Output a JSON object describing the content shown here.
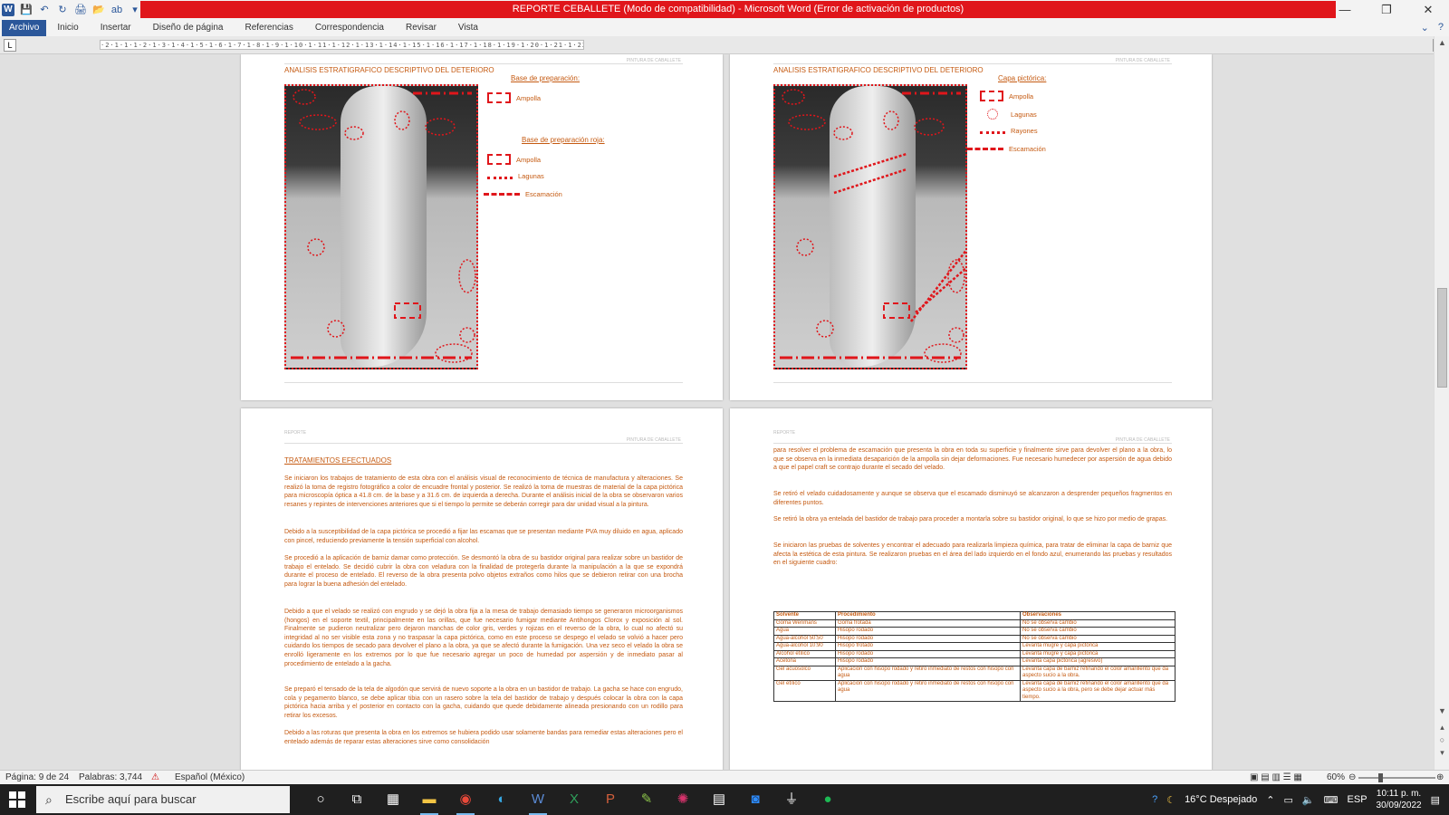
{
  "window": {
    "title": "REPORTE CEBALLETE (Modo de compatibilidad) - Microsoft Word (Error de activación de productos)",
    "min": "—",
    "max": "❐",
    "close": "✕"
  },
  "ribbon": {
    "tabs": [
      "Archivo",
      "Inicio",
      "Insertar",
      "Diseño de página",
      "Referencias",
      "Correspondencia",
      "Revisar",
      "Vista"
    ]
  },
  "ruler": {
    "text": "·2·1·1·1·2·1·3·1·4·1·5·1·6·1·7·1·8·1·9·1·10·1·11·1·12·1·13·1·14·1·15·1·16·1·17·1·18·1·19·1·20·1·21·1·22·1·23·1·24·1"
  },
  "page1": {
    "title": "ANALISIS ESTRATIGRAFICO DESCRIPTIVO DEL DETERIORO",
    "header": "PINTURA DE CABALLETE",
    "legend_title1": "Base de preparación:",
    "legend_title2": "Base de preparación roja:",
    "items": [
      "Ampolla",
      "Ampolla",
      "Lagunas",
      "Escamación"
    ]
  },
  "page2": {
    "title": "ANALISIS ESTRATIGRAFICO DESCRIPTIVO DEL DETERIORO",
    "header": "PINTURA DE CABALLETE",
    "legend_title": "Capa pictórica:",
    "items": [
      "Ampolla",
      "Lagunas",
      "Rayones",
      "Escamación"
    ]
  },
  "page3": {
    "header_left": "REPORTE",
    "header_right": "PINTURA DE CABALLETE",
    "title": "TRATAMIENTOS EFECTUADOS",
    "paragraphs": [
      "Se iniciaron los trabajos de tratamiento de esta obra con el análisis visual de reconocimiento de técnica de manufactura y alteraciones. Se realizó la toma de registro fotográfico a color de encuadre frontal y posterior. Se realizó la toma de muestras de material de la capa pictórica para microscopía óptica a 41.8 cm. de la base y a 31.6 cm. de izquierda a derecha. Durante el análisis inicial de la obra se observaron varios resanes y repintes de intervenciones anteriores que si el tiempo lo permite se deberán corregir para dar unidad visual a la pintura.",
      "Debido a la susceptibilidad de la capa pictórica se procedió a fijar las escamas que se presentan mediante PVA muy diluido en agua, aplicado con pincel, reduciendo previamente la tensión superficial con alcohol.",
      "Se procedió a la aplicación de barniz damar como protección. Se desmontó la obra de su bastidor original para realizar sobre un bastidor de trabajo el entelado. Se decidió cubrir la obra con veladura con la finalidad de protegerla durante la manipulación a la que se expondrá durante el proceso de entelado. El reverso de la obra presenta polvo objetos extraños como hilos que se debieron retirar con una brocha para lograr la buena adhesión del entelado.",
      "Debido a que el velado se realizó con engrudo y se dejó la obra fija a la mesa de trabajo demasiado tiempo se generaron microorganismos (hongos) en el soporte textil, principalmente en las orillas, que fue necesario fumigar mediante Antihongos Clorox y exposición al sol. Finalmente se pudieron neutralizar pero dejaron manchas de color gris, verdes y rojizas en el reverso de la obra, lo cual no afectó su integridad al no ser visible esta zona y no traspasar la capa pictórica, como en este proceso se despego el velado se volvió a hacer pero cuidando los tiempos de secado para devolver el plano a la obra, ya que se afectó durante la fumigación. Una vez seco el velado la obra se enrolló ligeramente en los extremos por lo que fue necesario agregar un poco de humedad por aspersión y de inmediato pasar al procedimiento de entelado a la gacha.",
      "Se preparó el tensado de la tela de algodón que servirá de nuevo soporte a la obra en un bastidor de trabajo. La gacha se hace con engrudo, cola y pegamento blanco, se debe aplicar tibia con un rasero sobre la tela del bastidor de trabajo y después colocar la obra con la capa pictórica hacia arriba y el posterior en contacto con la gacha, cuidando que quede debidamente alineada presionando con un rodillo para retirar los excesos.",
      "Debido a las roturas que presenta la obra en los extremos se hubiera podido usar solamente bandas para remediar estas alteraciones pero el entelado además de reparar estas alteraciones sirve como consolidación"
    ]
  },
  "page4": {
    "header_left": "REPORTE",
    "header_right": "PINTURA DE CABALLETE",
    "paragraphs": [
      "para resolver el problema de escamación que presenta la obra en toda su superficie y finalmente sirve para devolver el plano a la obra, lo que se observa en la inmediata desaparición de la ampolla sin dejar deformaciones. Fue necesario humedecer por aspersión de agua debido a que el papel craft se contrajo durante el secado del velado.",
      "Se retiró el velado cuidadosamente y aunque se observa que el escamado disminuyó se alcanzaron a desprender pequeños fragmentos en diferentes puntos.",
      "Se retiró la obra ya entelada del bastidor de trabajo para proceder a montarla sobre su bastidor original, lo que se hizo por medio de grapas.",
      "Se iniciaron las pruebas de solventes y encontrar el adecuado para realizarla limpieza química, para tratar de eliminar la capa de barniz que afecta la estética de esta pintura. Se realizaron pruebas en el área del lado izquierdo en el fondo azul, enumerando las pruebas y resultados en el siguiente cuadro:"
    ],
    "table": {
      "headers": [
        "Solvente",
        "Procedimiento",
        "Observaciones"
      ],
      "rows": [
        [
          "Goma Wenmans",
          "Goma frotada",
          "No se observa cambio"
        ],
        [
          "Agua",
          "Hisopo rodado",
          "No se observa cambio"
        ],
        [
          "Agua-alcohol 50:50",
          "Hisopo rodado",
          "No se observa cambio"
        ],
        [
          "Agua-alcohol 10:90",
          "Hisopo frotado",
          "Levanta mugre y capa pictórica"
        ],
        [
          "Alcohol etílico",
          "Hisopo rodado",
          "Levanta mugre y capa pictórica"
        ],
        [
          "Acetona",
          "Hisopo rodado",
          "Levanta capa pictórica (agresivo)"
        ],
        [
          "Gel acuosolco",
          "Aplicación con hisopo rodado y retiro inmediato de restos con hisopo con agua",
          "Levanta capa de barniz refinando el color amarillento que da aspecto sucio a la obra."
        ],
        [
          "Gel etílico",
          "Aplicación con hisopo rodado y retiro inmediato de restos con hisopo con agua",
          "Levanta capa de barniz refinando el color amarillento que da aspecto sucio a la obra, pero se debe dejar actuar más tiempo."
        ]
      ]
    }
  },
  "status": {
    "page": "Página: 9 de 24",
    "words": "Palabras: 3,744",
    "language": "Español (México)",
    "zoom": "60%"
  },
  "taskbar": {
    "search_placeholder": "Escribe aquí para buscar",
    "weather": "16°C  Despejado",
    "lang": "ESP",
    "time": "10:11 p. m.",
    "date": "30/09/2022"
  },
  "colors": {
    "accent": "#2b579a",
    "title_red": "#e0161b",
    "text_orange": "#c55a11"
  }
}
